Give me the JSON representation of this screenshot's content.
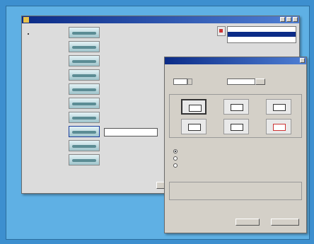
{
  "colors": {
    "background": "#3d8fcf",
    "titlebar": "#0b2b87",
    "window": "#dcdcdc"
  },
  "main_window": {
    "title": "",
    "sidebar": {
      "items": [
        "",
        "",
        "",
        ""
      ],
      "selected_index": 1
    },
    "rows": [
      {
        "text": "",
        "selected": false
      },
      {
        "text": "",
        "selected": false
      },
      {
        "text": "",
        "selected": false
      },
      {
        "text": "",
        "selected": false
      },
      {
        "text": "",
        "selected": false
      },
      {
        "text": "",
        "selected": false
      },
      {
        "text": "",
        "selected": false
      },
      {
        "text": "",
        "selected": true
      },
      {
        "text": "",
        "selected": false
      },
      {
        "text": "",
        "selected": false
      }
    ],
    "buttons": {
      "close": ""
    }
  },
  "dialog": {
    "title": "",
    "section_options": "",
    "field_a": {
      "label": "",
      "value": ""
    },
    "field_b": {
      "label": "",
      "value": ""
    },
    "section_position": "",
    "position_active_index": 0,
    "position_highlight_index": 5,
    "section_method": "",
    "radios": [
      {
        "label": "",
        "checked": true
      },
      {
        "label": "",
        "checked": false
      },
      {
        "label": "",
        "checked": false
      }
    ],
    "section_results": "",
    "results": {
      "headers": [
        "",
        "",
        ""
      ],
      "values": [
        "",
        "",
        ""
      ]
    },
    "buttons": {
      "ok": "",
      "cancel": ""
    }
  }
}
